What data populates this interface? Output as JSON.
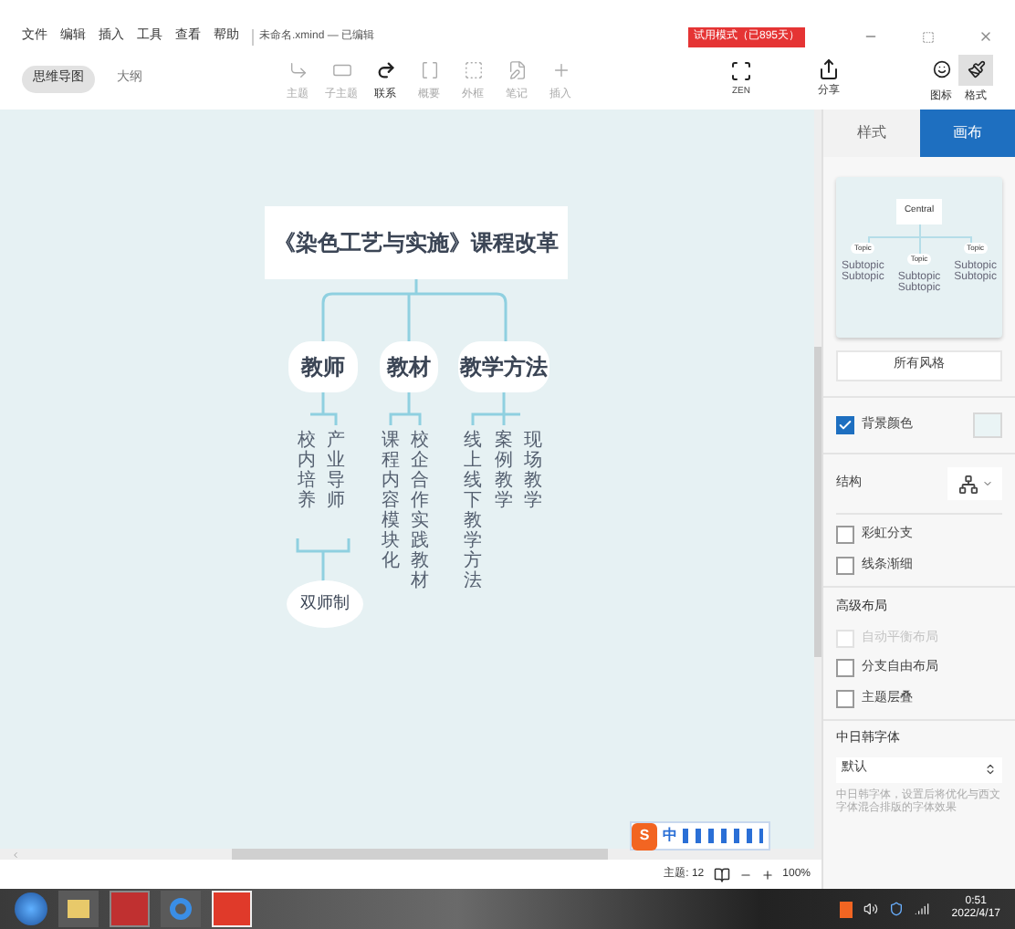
{
  "menu": [
    "文件",
    "编辑",
    "插入",
    "工具",
    "查看",
    "帮助"
  ],
  "document_title": "未命名.xmind — 已编辑",
  "trial_badge": "试用模式（已895天）",
  "view_tabs": [
    {
      "label": "思维导图",
      "selected": true
    },
    {
      "label": "大纲",
      "selected": false
    }
  ],
  "tools": [
    {
      "label": "主题",
      "kind": "topic",
      "disabled": true
    },
    {
      "label": "子主题",
      "kind": "subtopic",
      "disabled": true
    },
    {
      "label": "联系",
      "kind": "relation",
      "disabled": false
    },
    {
      "label": "概要",
      "kind": "summary",
      "disabled": true
    },
    {
      "label": "外框",
      "kind": "boundary",
      "disabled": true
    },
    {
      "label": "笔记",
      "kind": "note",
      "disabled": true
    },
    {
      "label": "插入",
      "kind": "insert",
      "disabled": true
    }
  ],
  "zen": {
    "label": "ZEN"
  },
  "share": {
    "label": "分享"
  },
  "panel_toggles": [
    {
      "label": "图标",
      "kind": "icon",
      "selected": false
    },
    {
      "label": "格式",
      "kind": "format",
      "selected": true
    }
  ],
  "map": {
    "root": "《染色工艺与实施》课程改革",
    "branches": [
      {
        "text": "教师",
        "children": [
          "校内培养",
          "产业导师"
        ],
        "summary": "双师制"
      },
      {
        "text": "教材",
        "children": [
          "课程内容模块化",
          "校企合作实践教材"
        ]
      },
      {
        "text": "教学方法",
        "children": [
          "线上线下教学方法",
          "案例教学",
          "现场教学"
        ]
      }
    ]
  },
  "panel": {
    "tabs": [
      {
        "label": "样式",
        "selected": false
      },
      {
        "label": "画布",
        "selected": true
      }
    ],
    "preview": {
      "central": "Central",
      "topics": [
        {
          "label": "Topic",
          "subtopics": [
            "Subtopic",
            "Subtopic"
          ]
        },
        {
          "label": "Topic",
          "subtopics": [
            "Subtopic",
            "Subtopic"
          ]
        },
        {
          "label": "Topic",
          "subtopics": [
            "Subtopic",
            "Subtopic"
          ]
        }
      ]
    },
    "all_styles_button": "所有风格",
    "background": {
      "label": "背景颜色",
      "checked": true,
      "color": "#eaf4f5"
    },
    "structure_label": "结构",
    "options": [
      {
        "label": "彩虹分支",
        "checked": false
      },
      {
        "label": "线条渐细",
        "checked": false
      }
    ],
    "advanced_title": "高级布局",
    "advanced": [
      {
        "label": "自动平衡布局",
        "checked": false,
        "disabled": true
      },
      {
        "label": "分支自由布局",
        "checked": false,
        "disabled": false
      },
      {
        "label": "主题层叠",
        "checked": false,
        "disabled": false
      }
    ],
    "font_title": "中日韩字体",
    "font_select": "默认",
    "font_hint": "中日韩字体，设置后将优化与西文字体混合排版的字体效果"
  },
  "ime_bar": {
    "logo": "S",
    "mode": "中"
  },
  "status_bar": {
    "topics": "主题: 12",
    "zoom": "100%"
  },
  "taskbar": {
    "time": "0:51",
    "date": "2022/4/17"
  }
}
